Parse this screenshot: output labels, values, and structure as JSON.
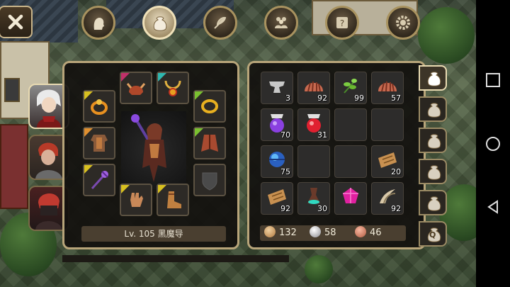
{
  "top_buttons": [
    {
      "id": "character",
      "icon": "head-icon",
      "active": false
    },
    {
      "id": "bag",
      "icon": "bag-icon",
      "active": true
    },
    {
      "id": "skills",
      "icon": "feather-icon",
      "active": false
    },
    {
      "id": "party",
      "icon": "party-icon",
      "active": false
    },
    {
      "id": "quest",
      "icon": "scroll-icon",
      "active": false
    },
    {
      "id": "settings",
      "icon": "gear-icon",
      "active": false
    }
  ],
  "characters": [
    {
      "id": "silver-hair-hero",
      "active": true
    },
    {
      "id": "red-hair-knight",
      "active": false
    },
    {
      "id": "masked-rogue",
      "active": false
    }
  ],
  "equipment": {
    "level_label": "Lv. 105 黑魔导",
    "slots": [
      {
        "slot": "helmet",
        "icon": "helmet-icon",
        "rarity_color": "#c0306a"
      },
      {
        "slot": "necklace",
        "icon": "necklace-icon",
        "rarity_color": "#2fb8b0"
      },
      {
        "slot": "ring-left",
        "icon": "ring-icon",
        "rarity_color": "#d8c020"
      },
      {
        "slot": "ring-right",
        "icon": "ring-icon",
        "rarity_color": "#7ac030"
      },
      {
        "slot": "armor",
        "icon": "armor-icon",
        "rarity_color": "#e09030"
      },
      {
        "slot": "cape",
        "icon": "cape-icon",
        "rarity_color": "#7ac030"
      },
      {
        "slot": "weapon",
        "icon": "staff-icon",
        "rarity_color": "#d8c020"
      },
      {
        "slot": "offhand",
        "icon": "shield-empty-icon",
        "rarity_color": ""
      },
      {
        "slot": "gloves",
        "icon": "glove-icon",
        "rarity_color": "#d8c020"
      },
      {
        "slot": "boots",
        "icon": "boot-icon",
        "rarity_color": "#d8c020"
      }
    ]
  },
  "inventory": {
    "items": [
      {
        "icon": "anvil-icon",
        "qty": "3"
      },
      {
        "icon": "shell-icon",
        "qty": "92"
      },
      {
        "icon": "herb-icon",
        "qty": "99"
      },
      {
        "icon": "shell-icon",
        "qty": "57"
      },
      {
        "icon": "purple-potion-icon",
        "qty": "70"
      },
      {
        "icon": "red-potion-icon",
        "qty": "31"
      },
      {
        "icon": "",
        "qty": ""
      },
      {
        "icon": "",
        "qty": ""
      },
      {
        "icon": "blue-orb-icon",
        "qty": "75"
      },
      {
        "icon": "",
        "qty": ""
      },
      {
        "icon": "",
        "qty": ""
      },
      {
        "icon": "parchment-icon",
        "qty": "20"
      },
      {
        "icon": "parchment-icon",
        "qty": "92"
      },
      {
        "icon": "green-potion-icon",
        "qty": "30"
      },
      {
        "icon": "pink-gem-icon",
        "qty": ""
      },
      {
        "icon": "claw-icon",
        "qty": "92"
      }
    ],
    "currency": [
      {
        "icon": "gold-coin-icon",
        "color": "#d8a868",
        "amount": "132"
      },
      {
        "icon": "silver-coin-icon",
        "color": "#c8c8cc",
        "amount": "58"
      },
      {
        "icon": "copper-coin-icon",
        "color": "#e08870",
        "amount": "46"
      }
    ]
  },
  "bag_tabs": [
    {
      "id": "bag-1",
      "active": true,
      "label": ""
    },
    {
      "id": "bag-2",
      "active": false,
      "label": ""
    },
    {
      "id": "bag-3",
      "active": false,
      "label": ""
    },
    {
      "id": "bag-4",
      "active": false,
      "label": ""
    },
    {
      "id": "bag-5",
      "active": false,
      "label": ""
    },
    {
      "id": "bag-quest",
      "active": false,
      "label": "Q"
    }
  ]
}
